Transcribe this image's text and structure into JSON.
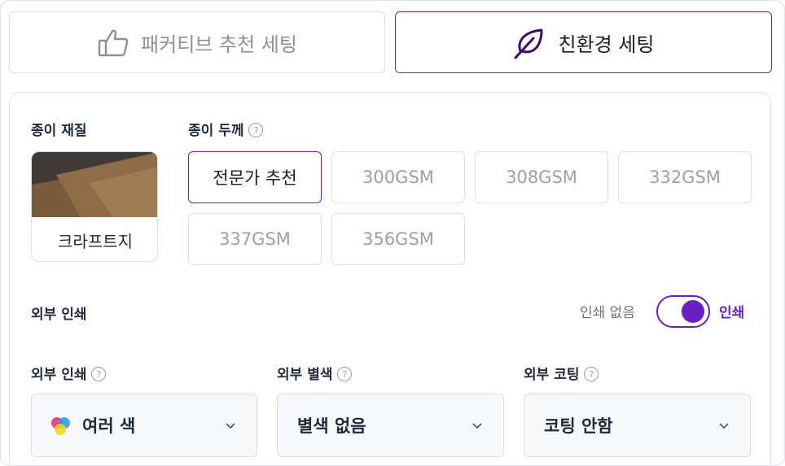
{
  "tabs": [
    {
      "label": "패커티브 추천 세팅",
      "icon": "thumbs-up-icon",
      "active": false
    },
    {
      "label": "친환경 세팅",
      "icon": "leaf-icon",
      "active": true
    }
  ],
  "colors": {
    "accent": "#6a1fc5",
    "border": "#dcdfe6",
    "muted_text": "#9aa0a8"
  },
  "paper": {
    "section_label": "종이 재질",
    "selected_name": "크라프트지"
  },
  "thickness": {
    "section_label": "종이 두께",
    "help_icon": "question-circle-icon",
    "options": [
      "전문가 추천",
      "300GSM",
      "308GSM",
      "332GSM",
      "337GSM",
      "356GSM"
    ],
    "selected": "전문가 추천"
  },
  "external_print": {
    "section_label": "외부 인쇄",
    "toggle_off_label": "인쇄 없음",
    "toggle_on_label": "인쇄",
    "toggle_on": true
  },
  "selects": [
    {
      "label": "외부 인쇄",
      "value": "여러 색",
      "icon": "multi-color-dots-icon"
    },
    {
      "label": "외부 별색",
      "value": "별색 없음"
    },
    {
      "label": "외부 코팅",
      "value": "코팅 안함"
    }
  ]
}
